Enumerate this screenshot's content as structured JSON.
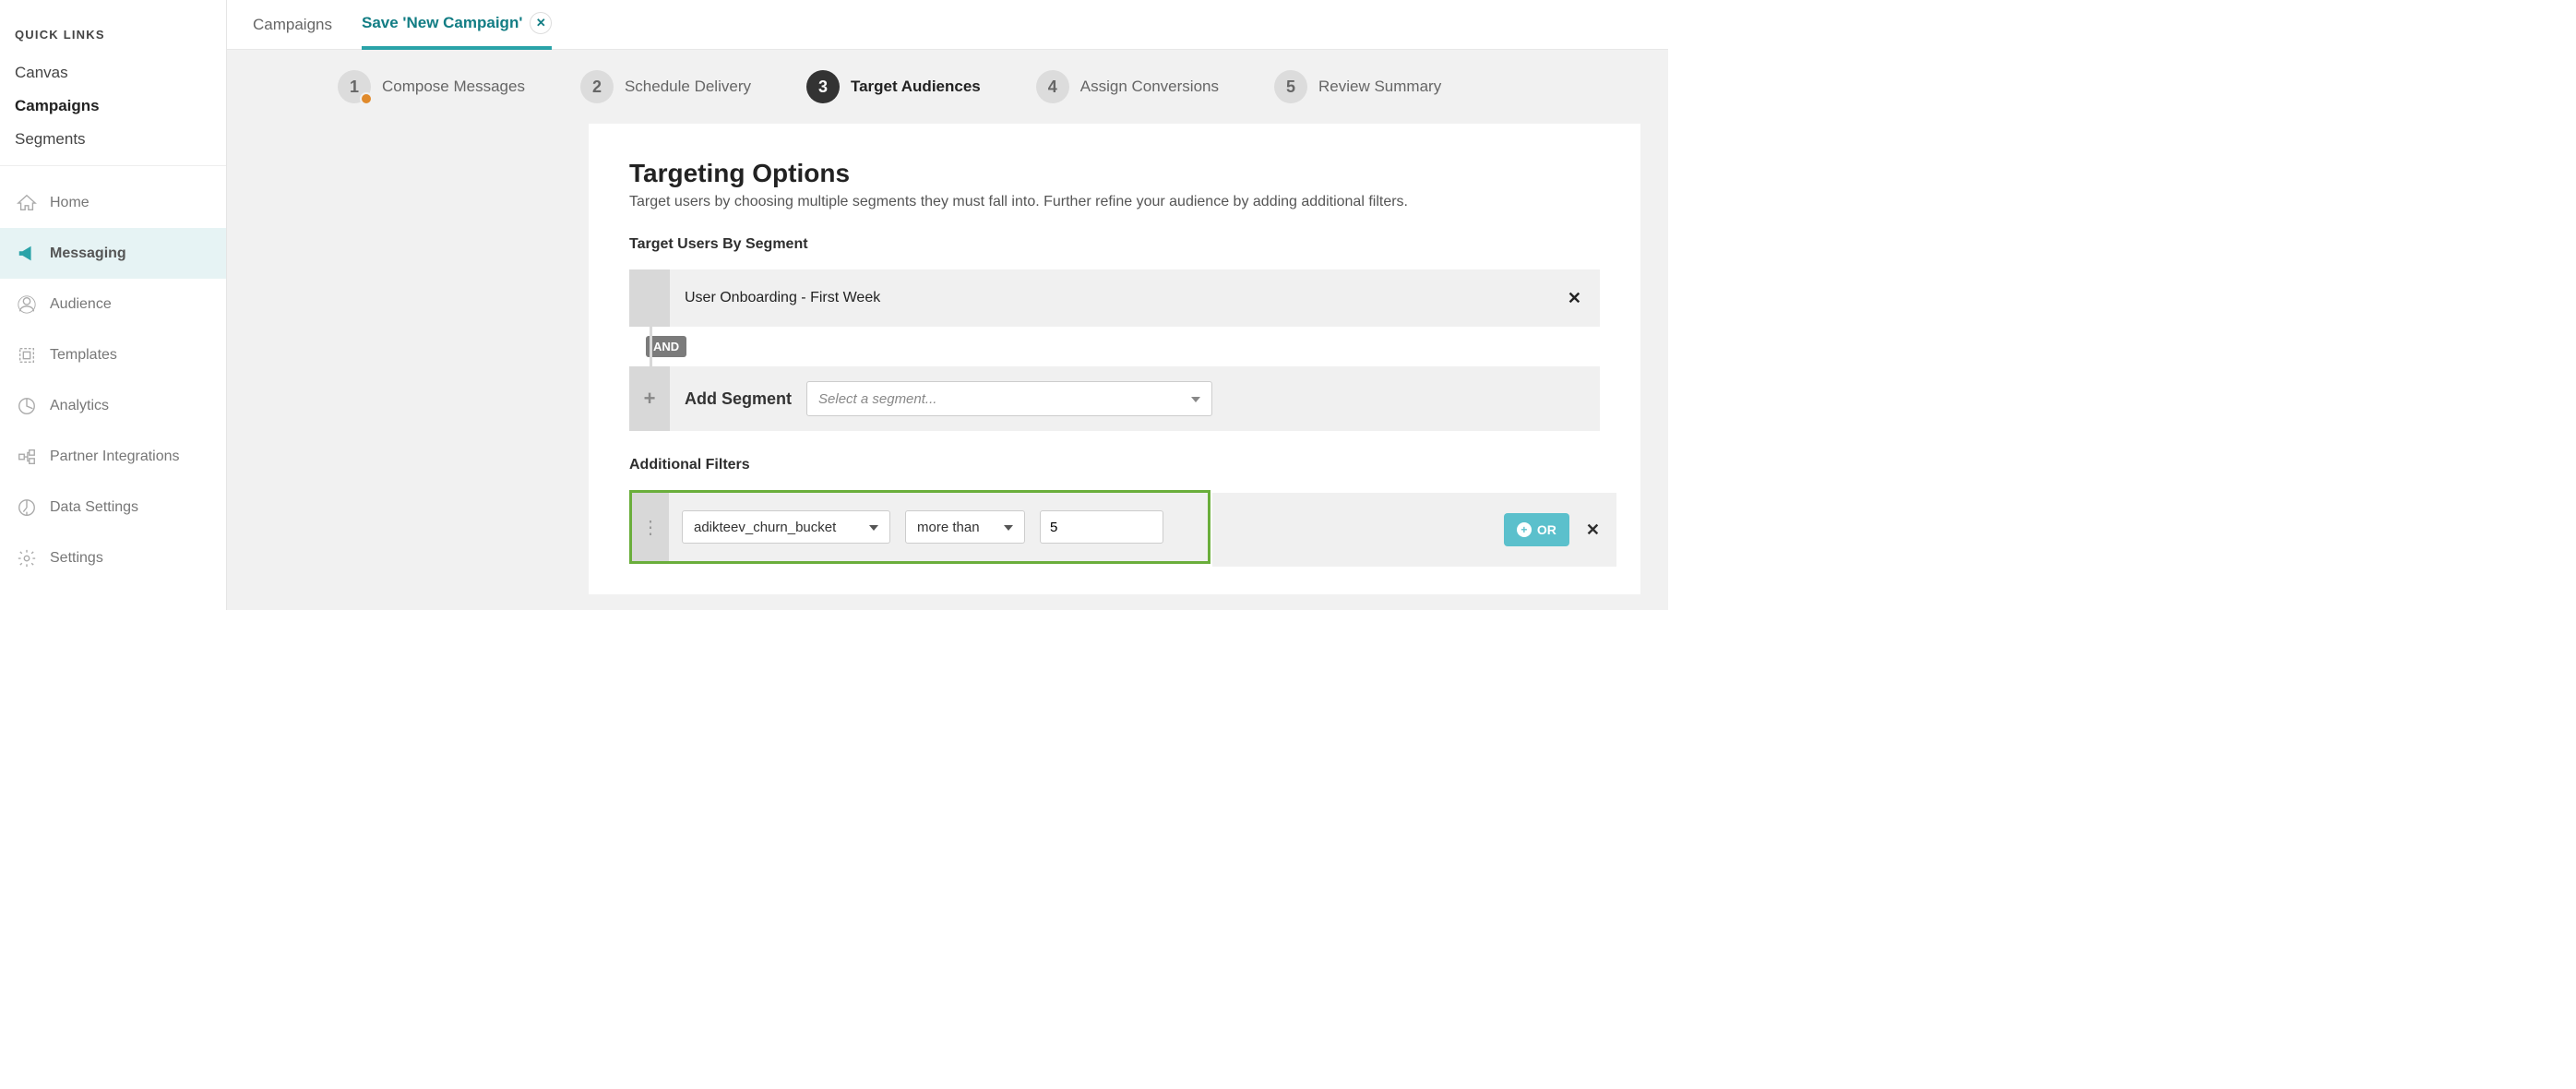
{
  "sidebar": {
    "quick_links_header": "QUICK LINKS",
    "quick": [
      {
        "label": "Canvas",
        "bold": false
      },
      {
        "label": "Campaigns",
        "bold": true
      },
      {
        "label": "Segments",
        "bold": false
      }
    ],
    "nav": [
      {
        "label": "Home",
        "icon": "home"
      },
      {
        "label": "Messaging",
        "icon": "messaging",
        "active": true
      },
      {
        "label": "Audience",
        "icon": "audience"
      },
      {
        "label": "Templates",
        "icon": "templates"
      },
      {
        "label": "Analytics",
        "icon": "analytics"
      },
      {
        "label": "Partner Integrations",
        "icon": "integrations"
      },
      {
        "label": "Data Settings",
        "icon": "data"
      },
      {
        "label": "Settings",
        "icon": "settings"
      }
    ]
  },
  "tabs": {
    "items": [
      {
        "label": "Campaigns",
        "active": false
      },
      {
        "label": "Save 'New Campaign'",
        "active": true,
        "closable": true
      }
    ]
  },
  "stepper": {
    "steps": [
      {
        "num": "1",
        "label": "Compose Messages",
        "warn": true
      },
      {
        "num": "2",
        "label": "Schedule Delivery"
      },
      {
        "num": "3",
        "label": "Target Audiences",
        "active": true
      },
      {
        "num": "4",
        "label": "Assign Conversions"
      },
      {
        "num": "5",
        "label": "Review Summary"
      }
    ]
  },
  "targeting": {
    "heading": "Targeting Options",
    "subtext": "Target users by choosing multiple segments they must fall into. Further refine your audience by adding additional filters.",
    "segments_label": "Target Users By Segment",
    "segment_name": "User Onboarding - First Week",
    "and_label": "AND",
    "add_segment_label": "Add Segment",
    "segment_placeholder": "Select a segment...",
    "filters_label": "Additional Filters",
    "filter_attr": "adikteev_churn_bucket",
    "filter_op": "more than",
    "filter_value": "5",
    "or_label": "OR",
    "highlight_color": "#6aae3b"
  }
}
